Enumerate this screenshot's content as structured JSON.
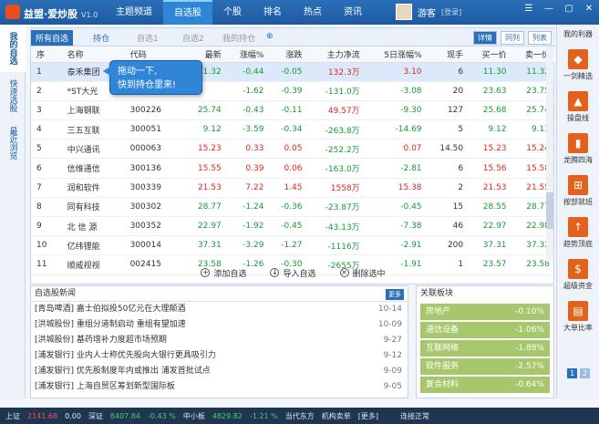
{
  "app": {
    "name": "益盟·爱炒股",
    "version": "V1.0"
  },
  "nav": [
    "主题频道",
    "自选股",
    "个股",
    "排名",
    "热点",
    "资讯"
  ],
  "user": {
    "name": "游客",
    "login": "[登录]"
  },
  "window_controls": [
    "☰",
    "—",
    "▢",
    "✕"
  ],
  "left_tabs": [
    "我的自选",
    "快速选股",
    "最近浏览"
  ],
  "subtabs": [
    "所有自选",
    "持仓",
    "自选1",
    "自选2",
    "我的持仓"
  ],
  "add_label": "⊕",
  "view_buttons": [
    "详情",
    "同列",
    "列表"
  ],
  "columns": [
    "序",
    "名称",
    "代码",
    "最新",
    "涨幅%",
    "涨跌",
    "主力净流",
    "5日涨幅%",
    "现手",
    "买一价",
    "卖一价"
  ],
  "rows": [
    {
      "n": "1",
      "name": "泰禾集团",
      "code": "000732",
      "last": "11.32",
      "pct": "-0.44",
      "chg": "-0.05",
      "flow": "132.3万",
      "d5": "3.10",
      "vol": "6",
      "bid": "11.30",
      "ask": "11.32"
    },
    {
      "n": "2",
      "name": "*ST大光",
      "code": "",
      "last": "",
      "pct": "-1.62",
      "chg": "-0.39",
      "flow": "-131.0万",
      "d5": "-3.08",
      "vol": "20",
      "bid": "23.63",
      "ask": "23.75"
    },
    {
      "n": "3",
      "name": "上海钢联",
      "code": "300226",
      "last": "25.74",
      "pct": "-0.43",
      "chg": "-0.11",
      "flow": "49.57万",
      "d5": "-9.30",
      "vol": "127",
      "bid": "25.68",
      "ask": "25.74"
    },
    {
      "n": "4",
      "name": "三五互联",
      "code": "300051",
      "last": "9.12",
      "pct": "-3.59",
      "chg": "-0.34",
      "flow": "-263.8万",
      "d5": "-14.69",
      "vol": "5",
      "bid": "9.12",
      "ask": "9.13"
    },
    {
      "n": "5",
      "name": "中兴通讯",
      "code": "000063",
      "last": "15.23",
      "pct": "0.33",
      "chg": "0.05",
      "flow": "-252.2万",
      "d5": "0.07",
      "vol": "14.50",
      "bid": "15.23",
      "ask": "15.24"
    },
    {
      "n": "6",
      "name": "信维通信",
      "code": "300136",
      "last": "15.55",
      "pct": "0.39",
      "chg": "0.06",
      "flow": "-163.0万",
      "d5": "-2.81",
      "vol": "6",
      "bid": "15.56",
      "ask": "15.58"
    },
    {
      "n": "7",
      "name": "润和软件",
      "code": "300339",
      "last": "21.53",
      "pct": "7.22",
      "chg": "1.45",
      "flow": "1558万",
      "d5": "15.38",
      "vol": "2",
      "bid": "21.53",
      "ask": "21.55"
    },
    {
      "n": "8",
      "name": "同有科技",
      "code": "300302",
      "last": "28.77",
      "pct": "-1.24",
      "chg": "-0.36",
      "flow": "-23.87万",
      "d5": "-0.45",
      "vol": "15",
      "bid": "28.55",
      "ask": "28.77"
    },
    {
      "n": "9",
      "name": "北 信 源",
      "code": "300352",
      "last": "22.97",
      "pct": "-1.92",
      "chg": "-0.45",
      "flow": "-43.13万",
      "d5": "-7.38",
      "vol": "46",
      "bid": "22.97",
      "ask": "22.98"
    },
    {
      "n": "10",
      "name": "亿纬锂能",
      "code": "300014",
      "last": "37.31",
      "pct": "-3.29",
      "chg": "-1.27",
      "flow": "-1116万",
      "d5": "-2.91",
      "vol": "200",
      "bid": "37.31",
      "ask": "37.32"
    },
    {
      "n": "11",
      "name": "顺威视视",
      "code": "002415",
      "last": "23.58",
      "pct": "-1.26",
      "chg": "-0.30",
      "flow": "-2655万",
      "d5": "-1.91",
      "vol": "1",
      "bid": "23.57",
      "ask": "23.58"
    }
  ],
  "tooltip": {
    "line1": "拖动一下,",
    "line2": "快到持仓里来!"
  },
  "actions": [
    "添加自选",
    "导入自选",
    "删除选中"
  ],
  "news": {
    "title": "自选股新闻",
    "more": "更多",
    "items": [
      {
        "text": "[青岛啤酒] 嘉士伯拟投50亿元在大理颠酒",
        "date": "10-14"
      },
      {
        "text": "[洪城股份] 重组分道制启动 重组有望加速",
        "date": "10-09"
      },
      {
        "text": "[洪城股份] 基药增补力度超市场预期",
        "date": "9-27"
      },
      {
        "text": "[浦发银行] 业内人士称优先股向大银行更具吸引力",
        "date": "9-12"
      },
      {
        "text": "[浦发银行] 优先股制度年内或推出 浦发首批试点",
        "date": "9-09"
      },
      {
        "text": "[浦发银行] 上海自贸区筹划新型国际板",
        "date": "9-05"
      }
    ]
  },
  "sectors": {
    "title": "关联板块",
    "items": [
      {
        "name": "房地产",
        "value": "-0.10%"
      },
      {
        "name": "通信设备",
        "value": "-1.06%"
      },
      {
        "name": "互联网络",
        "value": "-1.88%"
      },
      {
        "name": "软件服务",
        "value": "-2.57%"
      },
      {
        "name": "复合材料",
        "value": "-0.64%"
      }
    ]
  },
  "right_panel": {
    "title": "我的利器",
    "items": [
      {
        "label": "一剑精选",
        "icon": "◆"
      },
      {
        "label": "操盘线",
        "icon": "▲"
      },
      {
        "label": "龙腾四海",
        "icon": "▮"
      },
      {
        "label": "按部就班",
        "icon": "⊞"
      },
      {
        "label": "趋势顶底",
        "icon": "↑"
      },
      {
        "label": "超级资金",
        "icon": "$"
      },
      {
        "label": "大单比率",
        "icon": "▤"
      }
    ],
    "pages": [
      "1",
      "2"
    ]
  },
  "status": {
    "sh_label": "上证",
    "sh_val": "2141.68",
    "sh_chg": "0.00",
    "sz_label": "深证",
    "sz_val": "8407.84",
    "sz_pct": "-0.43 %",
    "zx_label": "中小板",
    "zx_val": "4829.82",
    "zx_pct": "-1.21 %",
    "stock": "当代东方",
    "msg": "机构卖单",
    "more": "[更多]",
    "conn": "连接正常"
  }
}
